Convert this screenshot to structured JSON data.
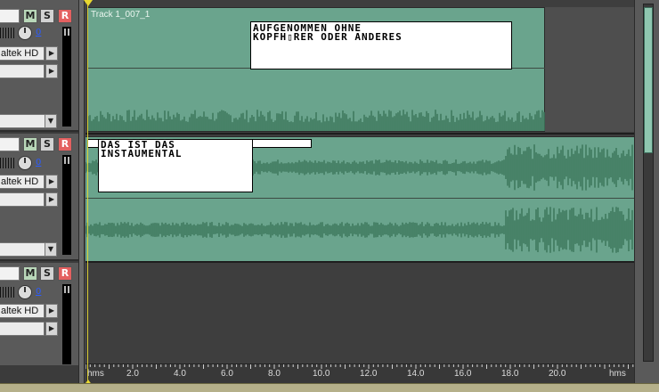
{
  "tracks": [
    {
      "mute_label": "M",
      "solo_label": "S",
      "record_label": "R",
      "volume_value": "0",
      "input_device": "altek HD"
    },
    {
      "mute_label": "M",
      "solo_label": "S",
      "record_label": "R",
      "volume_value": "0",
      "input_device": "altek HD"
    },
    {
      "mute_label": "M",
      "solo_label": "S",
      "record_label": "R",
      "volume_value": "0",
      "input_device": "altek HD"
    }
  ],
  "clip1": {
    "title": "Track 1_007_1"
  },
  "notes": {
    "note1_line1": "AUFGENOMMEN OHNE",
    "note1_line2": "KOPFH▯RER ODER ANDERES",
    "note2_line1": "DAS IST DAS",
    "note2_line2": "INSTAUMENTAL"
  },
  "ruler": {
    "start_label": "hms",
    "end_label": "hms",
    "labels": [
      "2.0",
      "4.0",
      "6.0",
      "8.0",
      "10.0",
      "12.0",
      "14.0",
      "16.0",
      "18.0",
      "20.0"
    ]
  },
  "colors": {
    "clip": "#6aa48d",
    "wave": "#3f7a5e",
    "accent": "#e8d830"
  },
  "icons": {
    "dropdown": "triangle-right-icon",
    "dropdown_down": "triangle-down-icon",
    "knob": "volume-knob-icon"
  }
}
